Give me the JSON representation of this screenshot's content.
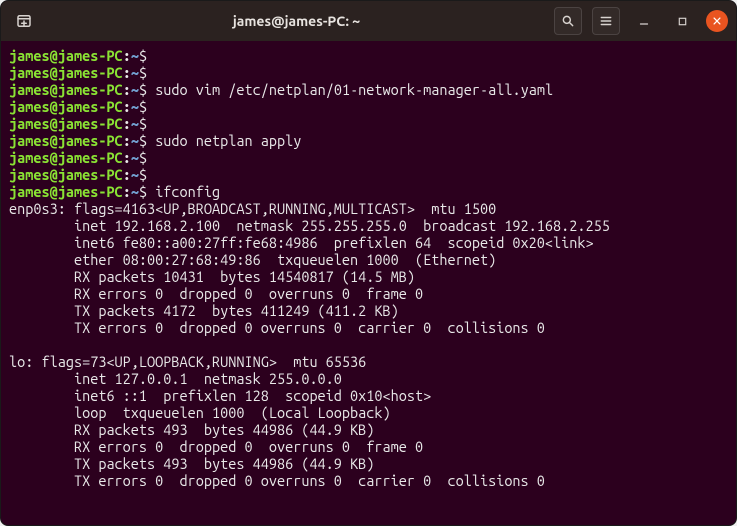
{
  "window": {
    "title": "james@james-PC: ~"
  },
  "prompt": {
    "userhost": "james@james-PC",
    "path": "~",
    "sigil": "$"
  },
  "lines": {
    "cmd1": "",
    "cmd2": "",
    "cmd3": "sudo vim /etc/netplan/01-network-manager-all.yaml",
    "cmd4": "",
    "cmd5": "",
    "cmd6": "sudo netplan apply",
    "cmd7": "",
    "cmd8": "",
    "cmd9": "ifconfig",
    "out1": "enp0s3: flags=4163<UP,BROADCAST,RUNNING,MULTICAST>  mtu 1500",
    "out2": "        inet 192.168.2.100  netmask 255.255.255.0  broadcast 192.168.2.255",
    "out3": "        inet6 fe80::a00:27ff:fe68:4986  prefixlen 64  scopeid 0x20<link>",
    "out4": "        ether 08:00:27:68:49:86  txqueuelen 1000  (Ethernet)",
    "out5": "        RX packets 10431  bytes 14540817 (14.5 MB)",
    "out6": "        RX errors 0  dropped 0  overruns 0  frame 0",
    "out7": "        TX packets 4172  bytes 411249 (411.2 KB)",
    "out8": "        TX errors 0  dropped 0 overruns 0  carrier 0  collisions 0",
    "out9": "",
    "out10": "lo: flags=73<UP,LOOPBACK,RUNNING>  mtu 65536",
    "out11": "        inet 127.0.0.1  netmask 255.0.0.0",
    "out12": "        inet6 ::1  prefixlen 128  scopeid 0x10<host>",
    "out13": "        loop  txqueuelen 1000  (Local Loopback)",
    "out14": "        RX packets 493  bytes 44986 (44.9 KB)",
    "out15": "        RX errors 0  dropped 0  overruns 0  frame 0",
    "out16": "        TX packets 493  bytes 44986 (44.9 KB)",
    "out17": "        TX errors 0  dropped 0 overruns 0  carrier 0  collisions 0"
  }
}
